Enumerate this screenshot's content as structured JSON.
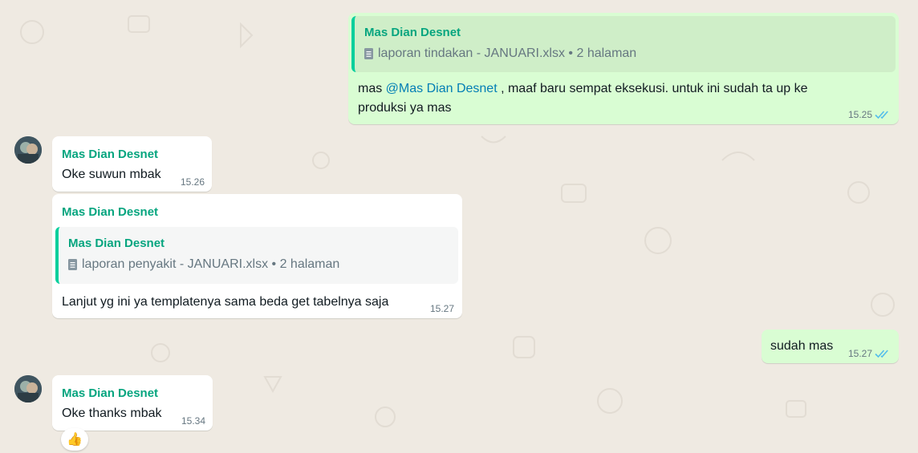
{
  "messages": {
    "m1": {
      "quote_sender": "Mas Dian Desnet",
      "quote_file": "laporan tindakan - JANUARI.xlsx • 2 halaman",
      "text_prefix": "mas ",
      "mention": "@Mas Dian Desnet",
      "text_line1_rest": " , maaf baru sempat eksekusi. untuk ini sudah ta up ke",
      "text_line2": "produksi ya mas",
      "time": "15.25"
    },
    "m2": {
      "sender": "Mas Dian Desnet",
      "text": "Oke suwun mbak",
      "time": "15.26"
    },
    "m3": {
      "sender": "Mas Dian Desnet",
      "quote_sender": "Mas Dian Desnet",
      "quote_file": "laporan penyakit - JANUARI.xlsx • 2 halaman",
      "text": "Lanjut yg ini ya templatenya sama beda get tabelnya saja",
      "time": "15.27"
    },
    "m4": {
      "text": "sudah mas",
      "time": "15.27"
    },
    "m5": {
      "sender": "Mas Dian Desnet",
      "text": "Oke thanks mbak",
      "time": "15.34",
      "reaction": "👍"
    }
  },
  "colors": {
    "background": "#efeae2",
    "incoming_bubble": "#ffffff",
    "outgoing_bubble": "#d9fdd3",
    "sender_name": "#06a57f",
    "mention": "#027eb5",
    "read_ticks": "#53bdeb"
  },
  "icons": {
    "file": "document-icon",
    "read_status": "double-check-icon",
    "avatar": "contact-avatar"
  }
}
